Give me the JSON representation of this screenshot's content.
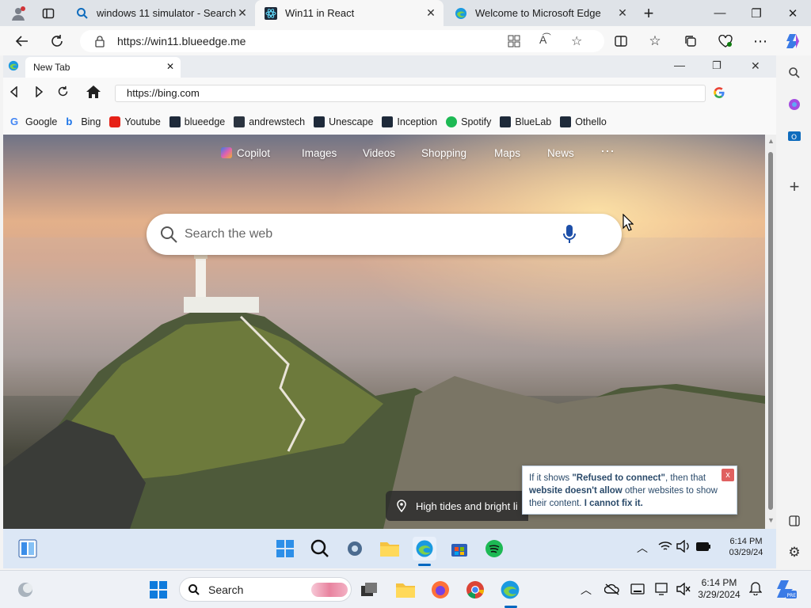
{
  "outer_tabs": [
    {
      "title": "windows 11 simulator - Search"
    },
    {
      "title": "Win11 in React"
    },
    {
      "title": "Welcome to Microsoft Edge"
    }
  ],
  "outer_url": "https://win11.blueedge.me",
  "inner": {
    "tab_title": "New Tab",
    "url": "https://bing.com",
    "bookmarks": [
      "Google",
      "Bing",
      "Youtube",
      "blueedge",
      "andrewstech",
      "Unescape",
      "Inception",
      "Spotify",
      "BlueLab",
      "Othello"
    ]
  },
  "bing": {
    "nav": [
      "Copilot",
      "Images",
      "Videos",
      "Shopping",
      "Maps",
      "News",
      "···"
    ],
    "search_placeholder": "Search the web",
    "caption": "High tides and bright li"
  },
  "note": {
    "p1": "If it shows ",
    "b1": "\"Refused to connect\"",
    "p2": ", then that ",
    "b2": "website doesn't allow",
    "p3": " other websites to show their content. ",
    "b3": "I cannot fix it.",
    "close": "x"
  },
  "inner_taskbar": {
    "time": "6:14 PM",
    "date": "03/29/24"
  },
  "taskbar": {
    "search_label": "Search",
    "time": "6:14 PM",
    "date": "3/29/2024"
  },
  "colors": {
    "accent": "#0067c0",
    "page_accent": "#3c7dd8"
  }
}
